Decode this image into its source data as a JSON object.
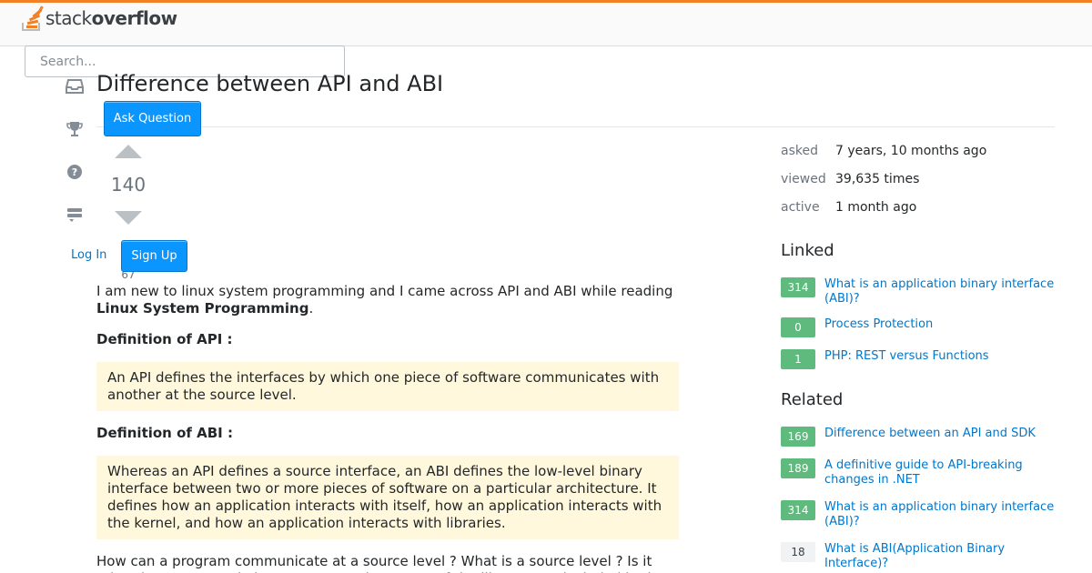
{
  "header": {
    "logo_text_light": "stack",
    "logo_text_bold": "overflow",
    "accent_color": "#f48024"
  },
  "search": {
    "placeholder": "Search..."
  },
  "question": {
    "title": "Difference between API and ABI",
    "votes": "140",
    "favorites": "67",
    "body": {
      "intro": "I am new to linux system programming and I came across API and ABI while reading ",
      "book": "Linux System Programming",
      "intro_end": ".",
      "api_heading": "Definition of API :",
      "api_quote": "An API defines the interfaces by which one piece of software communicates with another at the source level.",
      "abi_heading": "Definition of ABI :",
      "abi_quote": "Whereas an API defines a source interface, an ABI defines the low-level binary interface between two or more pieces of software on a particular architecture. It defines how an application interacts with itself, how an application interacts with the kernel, and how an application interacts with libraries.",
      "outro": "How can a program communicate at a source level ? What is a source level ? Is it related to source code in anyway ? Or the source of the library gets included in the"
    }
  },
  "buttons": {
    "ask_question": "Ask Question",
    "sign_up": "Sign Up",
    "log_in": "Log In"
  },
  "left_nav": {
    "icons": [
      "inbox-icon",
      "trophy-icon",
      "help-icon",
      "review-queue-icon"
    ]
  },
  "stats": [
    {
      "label": "asked",
      "value": "7 years, 10 months ago"
    },
    {
      "label": "viewed",
      "value": "39,635 times"
    },
    {
      "label": "active",
      "value": "1 month ago"
    }
  ],
  "linked": {
    "heading": "Linked",
    "items": [
      {
        "count": "314",
        "title": "What is an application binary interface (ABI)?"
      },
      {
        "count": "0",
        "title": "Process Protection"
      },
      {
        "count": "1",
        "title": "PHP: REST versus Functions"
      }
    ]
  },
  "related": {
    "heading": "Related",
    "items": [
      {
        "count": "169",
        "title": "Difference between an API and SDK"
      },
      {
        "count": "189",
        "title": "A definitive guide to API-breaking changes in .NET"
      },
      {
        "count": "314",
        "title": "What is an application binary interface (ABI)?"
      },
      {
        "count": "18",
        "title": "What is ABI(Application Binary Interface)?"
      }
    ]
  },
  "colors": {
    "accepted_answer_green": "#5eba7d",
    "link_blue": "#0077cc",
    "button_blue": "#0a95ff",
    "quote_bg": "#fff8dc"
  }
}
